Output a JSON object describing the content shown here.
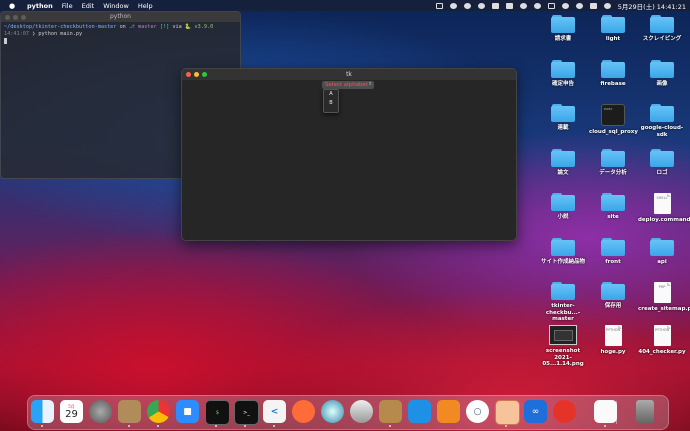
{
  "menubar": {
    "app": "python",
    "items": [
      "File",
      "Edit",
      "Window",
      "Help"
    ],
    "datetime": "5月29日(土)  14:41:21"
  },
  "terminal": {
    "title": "python",
    "path": "~/desktop/tkinter-checkbutton-master",
    "on": "on",
    "branch": "master",
    "git_status": "[!]",
    "via": "via",
    "version": "v3.9.0",
    "time": "14:41:07",
    "prompt": "❯",
    "command": "python main.py"
  },
  "tk_window": {
    "title": "tk",
    "select_label": "Select alphabet",
    "options": [
      "A",
      "B"
    ]
  },
  "desktop": {
    "icons": [
      {
        "label": "請求書",
        "kind": "folder"
      },
      {
        "label": "light",
        "kind": "folder"
      },
      {
        "label": "スクレイピング",
        "kind": "folder"
      },
      {
        "label": "確定申告",
        "kind": "folder"
      },
      {
        "label": "firebase",
        "kind": "folder"
      },
      {
        "label": "画像",
        "kind": "folder"
      },
      {
        "label": "連載",
        "kind": "folder"
      },
      {
        "label": "cloud_sql_proxy",
        "kind": "terminal"
      },
      {
        "label": "google-cloud-sdk",
        "kind": "folder"
      },
      {
        "label": "論文",
        "kind": "folder"
      },
      {
        "label": "データ分析",
        "kind": "folder"
      },
      {
        "label": "ロゴ",
        "kind": "folder"
      },
      {
        "label": "小説",
        "kind": "folder"
      },
      {
        "label": "site",
        "kind": "folder"
      },
      {
        "label": "deploy.command",
        "kind": "doc",
        "doc_kind": "SHELL"
      },
      {
        "label": "サイト作成納品物",
        "kind": "folder"
      },
      {
        "label": "front",
        "kind": "folder"
      },
      {
        "label": "api",
        "kind": "folder"
      },
      {
        "label": "tkinter-checkbu...-master",
        "kind": "folder"
      },
      {
        "label": "保存用",
        "kind": "folder"
      },
      {
        "label": "create_sitemap.php",
        "kind": "doc",
        "doc_kind": "PHP"
      },
      {
        "label": "screenshot 2021-05...1.14.png",
        "kind": "screenshot"
      },
      {
        "label": "hoge.py",
        "kind": "doc",
        "doc_kind": "PYTHON"
      },
      {
        "label": "404_checker.py",
        "kind": "doc",
        "doc_kind": "PYTHON"
      }
    ]
  },
  "dock": {
    "calendar_month": "5月",
    "calendar_day": "29",
    "apps": [
      "finder-icon",
      "calendar-icon",
      "system-preferences-icon",
      "contacts-icon",
      "chrome-icon",
      "zoom-icon",
      "iterm-icon",
      "terminal-icon",
      "vscode-icon",
      "postman-icon",
      "quicktime-icon",
      "sequel-pro-icon",
      "archive-utility-icon",
      "docker-icon",
      "sourcetree-icon",
      "rocket-icon",
      "preview-icon",
      "infinity-icon",
      "clock-icon",
      "document-icon",
      "trash-icon"
    ]
  },
  "colors": {
    "folder": "#4fb0ea",
    "select_text": "#ff4d4d"
  }
}
